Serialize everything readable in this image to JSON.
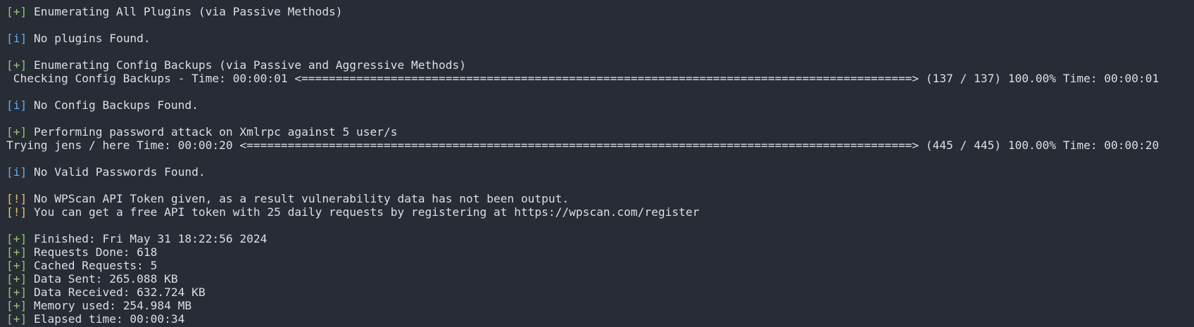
{
  "colors": {
    "background": "#282c34",
    "foreground": "#dcdfe4",
    "plus_tag": "#98c379",
    "info_tag": "#61afef",
    "warn_tag": "#e5c07b"
  },
  "lines": [
    {
      "tag": "[+]",
      "kind": "plus",
      "text": " Enumerating All Plugins (via Passive Methods)"
    },
    {
      "tag": "",
      "kind": "blank",
      "text": ""
    },
    {
      "tag": "[i]",
      "kind": "info",
      "text": " No plugins Found."
    },
    {
      "tag": "",
      "kind": "blank",
      "text": ""
    },
    {
      "tag": "[+]",
      "kind": "plus",
      "text": " Enumerating Config Backups (via Passive and Aggressive Methods)"
    },
    {
      "tag": "",
      "kind": "progress",
      "text": " Checking Config Backups - Time: 00:00:01 <=========================================================================================> (137 / 137) 100.00% Time: 00:00:01"
    },
    {
      "tag": "",
      "kind": "blank",
      "text": ""
    },
    {
      "tag": "[i]",
      "kind": "info",
      "text": " No Config Backups Found."
    },
    {
      "tag": "",
      "kind": "blank",
      "text": ""
    },
    {
      "tag": "[+]",
      "kind": "plus",
      "text": " Performing password attack on Xmlrpc against 5 user/s"
    },
    {
      "tag": "",
      "kind": "progress",
      "text": "Trying jens / here Time: 00:00:20 <=================================================================================================> (445 / 445) 100.00% Time: 00:00:20"
    },
    {
      "tag": "",
      "kind": "blank",
      "text": ""
    },
    {
      "tag": "[i]",
      "kind": "info",
      "text": " No Valid Passwords Found."
    },
    {
      "tag": "",
      "kind": "blank",
      "text": ""
    },
    {
      "tag": "[!]",
      "kind": "warn",
      "text": " No WPScan API Token given, as a result vulnerability data has not been output."
    },
    {
      "tag": "[!]",
      "kind": "warn",
      "text": " You can get a free API token with 25 daily requests by registering at https://wpscan.com/register"
    },
    {
      "tag": "",
      "kind": "blank",
      "text": ""
    },
    {
      "tag": "[+]",
      "kind": "plus",
      "text": " Finished: Fri May 31 18:22:56 2024"
    },
    {
      "tag": "[+]",
      "kind": "plus",
      "text": " Requests Done: 618"
    },
    {
      "tag": "[+]",
      "kind": "plus",
      "text": " Cached Requests: 5"
    },
    {
      "tag": "[+]",
      "kind": "plus",
      "text": " Data Sent: 265.088 KB"
    },
    {
      "tag": "[+]",
      "kind": "plus",
      "text": " Data Received: 632.724 KB"
    },
    {
      "tag": "[+]",
      "kind": "plus",
      "text": " Memory used: 254.984 MB"
    },
    {
      "tag": "[+]",
      "kind": "plus",
      "text": " Elapsed time: 00:00:34"
    }
  ]
}
